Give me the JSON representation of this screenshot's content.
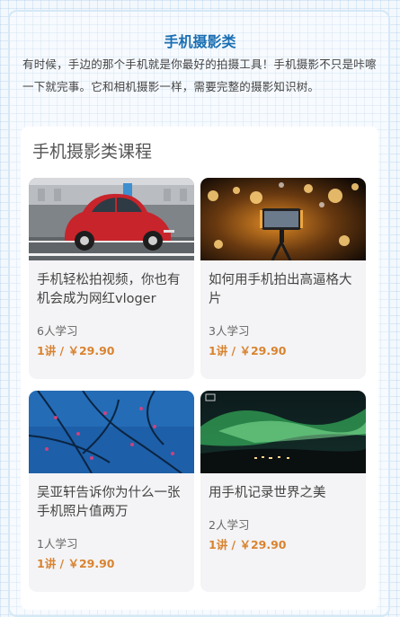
{
  "header": {
    "title": "手机摄影类",
    "intro": "有时候，手边的那个手机就是你最好的拍摄工具！手机摄影不只是咔嚓一下就完事。它和相机摄影一样，需要完整的摄影知识树。"
  },
  "section": {
    "title": "手机摄影类课程"
  },
  "courses": [
    {
      "title": "手机轻松拍视频，你也有机会成为网红vloger",
      "learners": "6人学习",
      "price": "1讲 / ￥29.90",
      "image": "red-beetle-car-photo"
    },
    {
      "title": "如何用手机拍出高逼格大片",
      "learners": "3人学习",
      "price": "1讲 / ￥29.90",
      "image": "phone-on-tripod-bokeh-photo"
    },
    {
      "title": "吴亚轩告诉你为什么一张手机照片值两万",
      "learners": "1人学习",
      "price": "1讲 / ￥29.90",
      "image": "blue-water-branches-photo"
    },
    {
      "title": "用手机记录世界之美",
      "learners": "2人学习",
      "price": "1讲 / ￥29.90",
      "image": "aurora-night-photo"
    }
  ],
  "colors": {
    "title": "#1a6fb3",
    "price": "#d9832f"
  }
}
